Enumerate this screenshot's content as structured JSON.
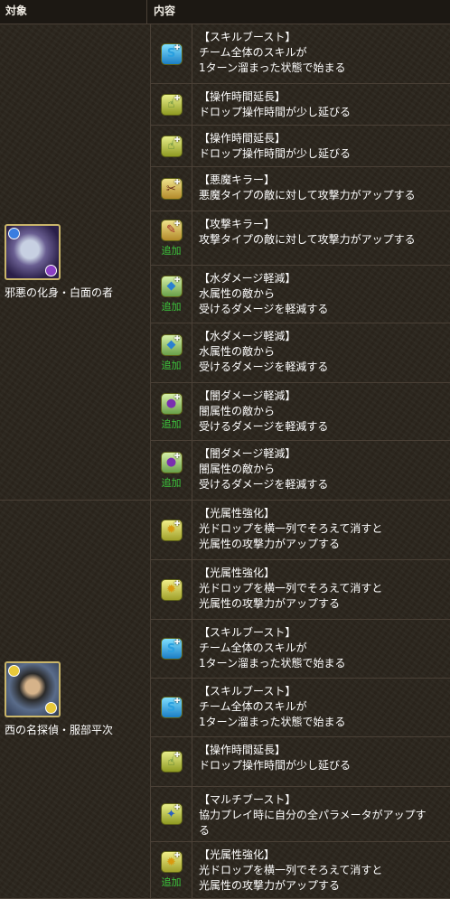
{
  "header": {
    "target": "対象",
    "content": "内容"
  },
  "added_label": "追加",
  "groups": [
    {
      "name": "邪悪の化身・白面の者",
      "rows": [
        {
          "icon": "skill-boost-icon",
          "title": "【スキルブースト】",
          "desc": [
            "チーム全体のスキルが",
            "1ターン溜まった状態で始まる"
          ],
          "added": false
        },
        {
          "icon": "time-extend-icon",
          "title": "【操作時間延長】",
          "desc": [
            "ドロップ操作時間が少し延びる"
          ],
          "added": false
        },
        {
          "icon": "time-extend-icon",
          "title": "【操作時間延長】",
          "desc": [
            "ドロップ操作時間が少し延びる"
          ],
          "added": false
        },
        {
          "icon": "devil-killer-icon",
          "title": "【悪魔キラー】",
          "desc": [
            "悪魔タイプの敵に対して攻撃力がアップする"
          ],
          "added": false
        },
        {
          "icon": "attack-killer-icon",
          "title": "【攻撃キラー】",
          "desc": [
            "攻撃タイプの敵に対して攻撃力がアップする"
          ],
          "added": true
        },
        {
          "icon": "water-reduce-icon",
          "title": "【水ダメージ軽減】",
          "desc": [
            "水属性の敵から",
            "受けるダメージを軽減する"
          ],
          "added": true
        },
        {
          "icon": "water-reduce-icon",
          "title": "【水ダメージ軽減】",
          "desc": [
            "水属性の敵から",
            "受けるダメージを軽減する"
          ],
          "added": true
        },
        {
          "icon": "dark-reduce-icon",
          "title": "【闇ダメージ軽減】",
          "desc": [
            "闇属性の敵から",
            "受けるダメージを軽減する"
          ],
          "added": true
        },
        {
          "icon": "dark-reduce-icon",
          "title": "【闇ダメージ軽減】",
          "desc": [
            "闇属性の敵から",
            "受けるダメージを軽減する"
          ],
          "added": true
        }
      ]
    },
    {
      "name": "西の名探偵・服部平次",
      "rows": [
        {
          "icon": "light-enhance-icon",
          "title": "【光属性強化】",
          "desc": [
            "光ドロップを横一列でそろえて消すと",
            "光属性の攻撃力がアップする"
          ],
          "added": false
        },
        {
          "icon": "light-enhance-icon",
          "title": "【光属性強化】",
          "desc": [
            "光ドロップを横一列でそろえて消すと",
            "光属性の攻撃力がアップする"
          ],
          "added": false
        },
        {
          "icon": "skill-boost-icon",
          "title": "【スキルブースト】",
          "desc": [
            "チーム全体のスキルが",
            "1ターン溜まった状態で始まる"
          ],
          "added": false
        },
        {
          "icon": "skill-boost-icon",
          "title": "【スキルブースト】",
          "desc": [
            "チーム全体のスキルが",
            "1ターン溜まった状態で始まる"
          ],
          "added": false
        },
        {
          "icon": "time-extend-icon",
          "title": "【操作時間延長】",
          "desc": [
            "ドロップ操作時間が少し延びる"
          ],
          "added": false
        },
        {
          "icon": "multi-boost-icon",
          "title": "【マルチブースト】",
          "desc": [
            "協力プレイ時に自分の全パラメータがアップす",
            "る"
          ],
          "added": false
        },
        {
          "icon": "light-enhance-icon",
          "title": "【光属性強化】",
          "desc": [
            "光ドロップを横一列でそろえて消すと",
            "光属性の攻撃力がアップする"
          ],
          "added": true
        }
      ]
    }
  ]
}
